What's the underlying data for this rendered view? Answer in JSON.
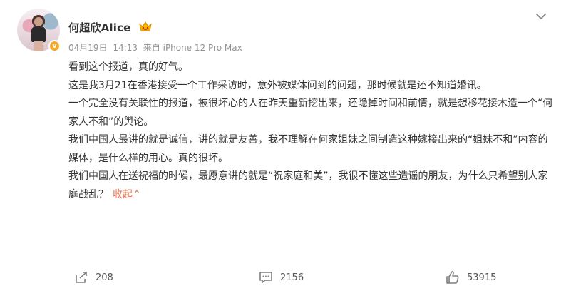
{
  "user": {
    "name": "何超欣Alice",
    "verified": true
  },
  "post": {
    "date": "04月19日",
    "time": "14:13",
    "source": "来自 iPhone 12 Pro Max",
    "paragraphs": [
      "看到这个报道，真的好气。",
      "这是我3月21在香港接受一个工作采访时，意外被媒体问到的问题，那时候就是还不知道婚讯。",
      "一个完全没有关联性的报道，被很坏心的人在昨天重新挖出来，还隐掉时间和前情，就是想移花接木造一个“何家人不和”的舆论。",
      "我们中国人最讲的就是诚信，讲的就是友善，我不理解在何家姐妹之间制造这种嫁接出来的“姐妹不和”内容的媒体，是什么样的用心。真的很坏。",
      "我们中国人在送祝福的时候，最愿意讲的就是“祝家庭和美”，我很不懂这些造谣的朋友，为什么只希望别人家庭战乱？"
    ],
    "expand_label": "收起⌃"
  },
  "actions": {
    "repost_count": "208",
    "comment_count": "2156",
    "like_count": "53915"
  },
  "icons": {
    "avatar_badge": "v-badge-icon",
    "member": "member-crown-icon",
    "menu": "chevron-down-icon",
    "repost": "share-icon",
    "comment": "comment-icon",
    "like": "thumbs-up-icon"
  },
  "colors": {
    "link": "#eb7350",
    "meta": "#939393",
    "badge": "#f5a623"
  }
}
